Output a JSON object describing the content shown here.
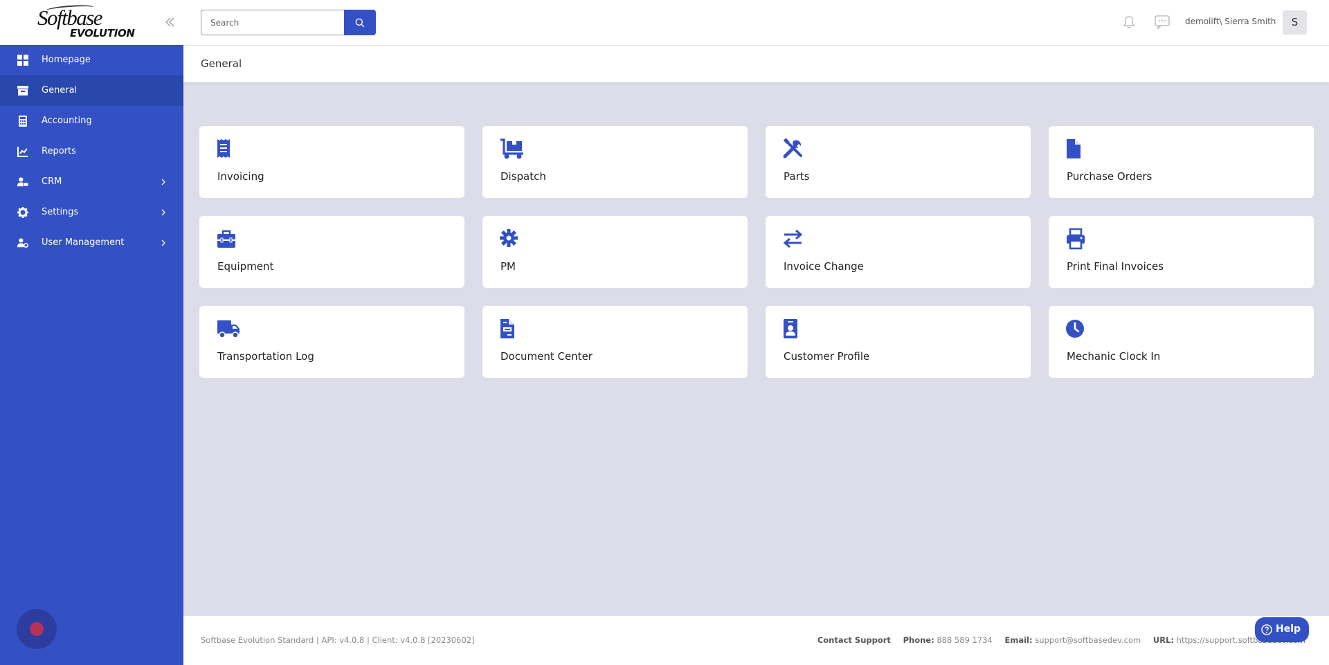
{
  "app": {
    "logo_top": "Softbase",
    "logo_bottom": "EVOLUTION",
    "accent_color": "#3350c4"
  },
  "sidebar": {
    "items": [
      {
        "label": "Homepage",
        "icon": "dashboard-icon"
      },
      {
        "label": "General",
        "icon": "archive-box-icon",
        "active": true
      },
      {
        "label": "Accounting",
        "icon": "calculator-icon"
      },
      {
        "label": "Reports",
        "icon": "chart-line-icon"
      },
      {
        "label": "CRM",
        "icon": "user-tie-icon",
        "has_children": true
      },
      {
        "label": "Settings",
        "icon": "gear-icon",
        "has_children": true
      },
      {
        "label": "User Management",
        "icon": "user-cog-icon",
        "has_children": true
      }
    ]
  },
  "header": {
    "search_placeholder": "Search",
    "user": "demolift\\ Sierra Smith",
    "avatar_initial": "S"
  },
  "breadcrumb": {
    "title": "General"
  },
  "tiles": [
    {
      "label": "Invoicing",
      "icon": "receipt-icon"
    },
    {
      "label": "Dispatch",
      "icon": "dolly-icon"
    },
    {
      "label": "Parts",
      "icon": "tools-icon"
    },
    {
      "label": "Purchase Orders",
      "icon": "file-icon"
    },
    {
      "label": "Equipment",
      "icon": "toolbox-icon"
    },
    {
      "label": "PM",
      "icon": "cog-icon"
    },
    {
      "label": "Invoice Change",
      "icon": "exchange-icon"
    },
    {
      "label": "Print Final Invoices",
      "icon": "printer-icon"
    },
    {
      "label": "Transportation Log",
      "icon": "truck-icon"
    },
    {
      "label": "Document Center",
      "icon": "file-text-icon"
    },
    {
      "label": "Customer Profile",
      "icon": "id-badge-icon"
    },
    {
      "label": "Mechanic Clock In",
      "icon": "clock-icon"
    }
  ],
  "footer": {
    "version": "Softbase Evolution Standard | API: v4.0.8 | Client: v4.0.8 [20230602]",
    "contact_support": "Contact Support",
    "phone_label": "Phone:",
    "phone": "888 589 1734",
    "email_label": "Email:",
    "email": "support@softbasedev.com",
    "url_label": "URL:",
    "url": "https://support.softbasedev.com"
  },
  "help": {
    "label": "Help"
  }
}
